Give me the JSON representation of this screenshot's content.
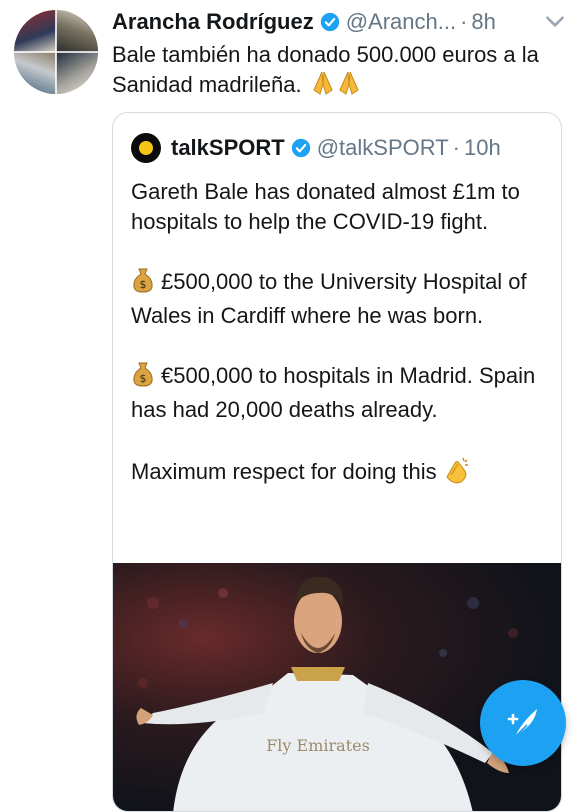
{
  "tweet": {
    "author_name": "Arancha Rodríguez",
    "author_handle": "@Aranch...",
    "separator": "·",
    "time": "8h",
    "text": "Bale también ha donado 500.000 euros a la Sanidad madrileña.",
    "emoji": "🙏🙏"
  },
  "quoted_tweet": {
    "author_name": "talkSPORT",
    "author_handle": "@talkSPORT",
    "separator": "·",
    "time": "10h",
    "paragraphs": [
      "Gareth Bale has donated almost £1m to hospitals to help the COVID-19 fight.",
      "£500,000 to the University Hospital of Wales in Cardiff where he was born.",
      "€500,000 to hospitals in Madrid. Spain has had 20,000 deaths already.",
      "Maximum respect for doing this"
    ],
    "media_caption": "Fly Emirates"
  },
  "fab": {
    "icon": "compose-tweet-icon"
  },
  "colors": {
    "accent": "#1da1f2",
    "secondary_text": "#657786",
    "border": "#d3dbe2"
  }
}
